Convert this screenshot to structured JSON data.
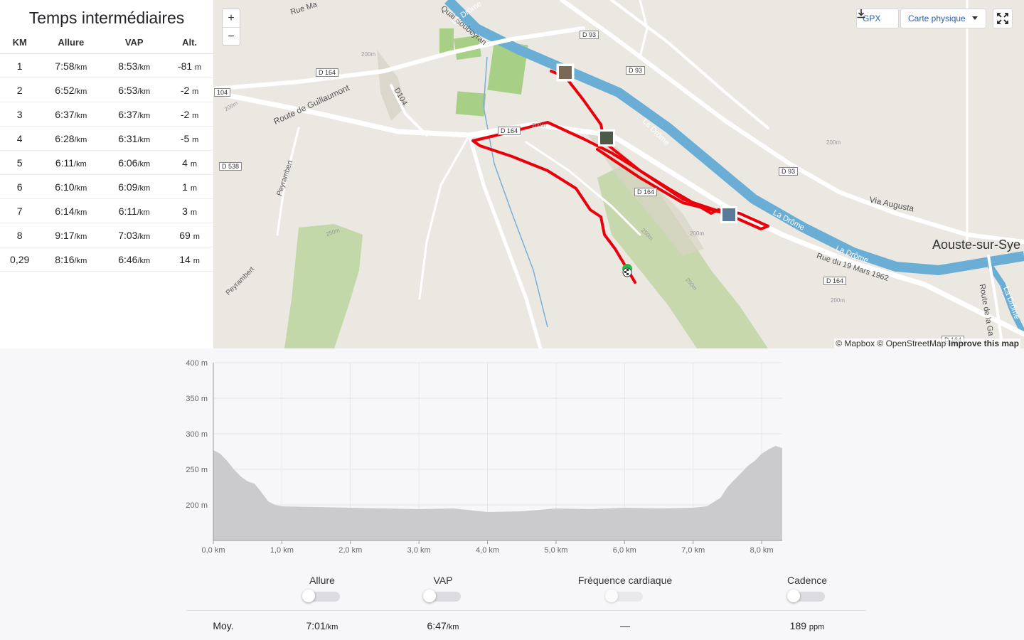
{
  "splits": {
    "title": "Temps intermédiaires",
    "headers": [
      "KM",
      "Allure",
      "VAP",
      "Alt."
    ],
    "pace_unit": "/km",
    "alt_unit": "m",
    "rows": [
      {
        "km": "1",
        "allure": "7:58",
        "vap": "8:53",
        "alt": "-81"
      },
      {
        "km": "2",
        "allure": "6:52",
        "vap": "6:53",
        "alt": "-2"
      },
      {
        "km": "3",
        "allure": "6:37",
        "vap": "6:37",
        "alt": "-2"
      },
      {
        "km": "4",
        "allure": "6:28",
        "vap": "6:31",
        "alt": "-5"
      },
      {
        "km": "5",
        "allure": "6:11",
        "vap": "6:06",
        "alt": "4"
      },
      {
        "km": "6",
        "allure": "6:10",
        "vap": "6:09",
        "alt": "1"
      },
      {
        "km": "7",
        "allure": "6:14",
        "vap": "6:11",
        "alt": "3"
      },
      {
        "km": "8",
        "allure": "9:17",
        "vap": "7:03",
        "alt": "69"
      },
      {
        "km": "0,29",
        "allure": "8:16",
        "vap": "6:46",
        "alt": "14"
      }
    ]
  },
  "map": {
    "zoom_in": "+",
    "zoom_out": "−",
    "gpx_label": "GPX",
    "map_type": "Carte physique",
    "attribution_1": "© Mapbox © OpenStreetMap",
    "attribution_2": "Improve this map",
    "labels": {
      "rue": "Rue Ma",
      "quai": "Quai Soubeyran",
      "drome1": "La Drôme",
      "drome2": "La Drôme",
      "drome3": "La Drôme",
      "drome4": "La Drôme",
      "drome5": "La Drôme",
      "guillaumont": "Route de Guillaumont",
      "d104": "D104",
      "peyr1": "Peyrambert",
      "peyr2": "Peyrambert",
      "augusta": "Via Augusta",
      "rue19": "Rue du 19 Mars 1962",
      "aouste": "Aouste-sur-Sye",
      "route_ga": "Route de la Ga",
      "c200a": "200m",
      "c200b": "200m",
      "c200c": "200m",
      "c200d": "200m",
      "c200e": "200m",
      "c200f": "200m",
      "c250a": "250m",
      "c250b": "250m",
      "c250c": "250m"
    },
    "shields": {
      "d93a": "D 93",
      "d93b": "D 93",
      "d93c": "D 93",
      "d164a": "D 164",
      "d164b": "D 164",
      "d164c": "D 164",
      "d164d": "D 164",
      "d164e": "D 164",
      "d538": "D 538",
      "s104": "104"
    },
    "colors": {
      "route": "#e8000b",
      "river": "#6aaed6",
      "park": "#a7d086",
      "land": "#ebe8e2"
    }
  },
  "elevation": {
    "y_ticks": [
      "400 m",
      "350 m",
      "300 m",
      "250 m",
      "200 m"
    ],
    "x_ticks": [
      "0,0 km",
      "1,0 km",
      "2,0 km",
      "3,0 km",
      "4,0 km",
      "5,0 km",
      "6,0 km",
      "7,0 km",
      "8,0 km"
    ],
    "chart_data": {
      "type": "area",
      "xlabel": "",
      "ylabel": "",
      "ylim": [
        150,
        400
      ],
      "xlim": [
        0,
        8.3
      ],
      "x": [
        0,
        0.1,
        0.2,
        0.3,
        0.4,
        0.5,
        0.6,
        0.7,
        0.8,
        0.9,
        1.0,
        1.5,
        2.0,
        2.5,
        3.0,
        3.5,
        4.0,
        4.5,
        5.0,
        5.5,
        6.0,
        6.5,
        7.0,
        7.2,
        7.4,
        7.5,
        7.6,
        7.7,
        7.8,
        7.9,
        8.0,
        8.1,
        8.2,
        8.3
      ],
      "y": [
        277,
        272,
        262,
        250,
        240,
        233,
        230,
        218,
        205,
        200,
        198,
        197,
        196,
        195,
        194,
        195,
        190,
        191,
        195,
        194,
        196,
        195,
        196,
        198,
        210,
        225,
        235,
        245,
        255,
        262,
        272,
        278,
        283,
        280
      ]
    }
  },
  "stats": {
    "labels": {
      "allure": "Allure",
      "vap": "VAP",
      "fc": "Fréquence cardiaque",
      "cadence": "Cadence"
    },
    "moy_label": "Moy.",
    "values": {
      "allure": "7:01",
      "vap": "6:47",
      "fc": "—",
      "cadence": "189"
    },
    "units": {
      "allure": "/km",
      "vap": "/km",
      "cadence": "ppm"
    }
  }
}
